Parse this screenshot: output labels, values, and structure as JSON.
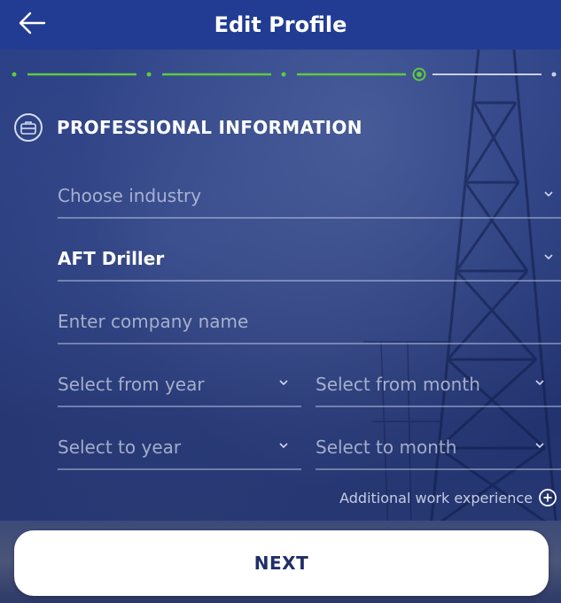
{
  "header": {
    "title": "Edit Profile",
    "back_icon": "arrow-left-icon"
  },
  "stepper": {
    "steps": 5,
    "current_step": 4,
    "active_color": "#5fc940",
    "inactive_color": "#c9d0e6"
  },
  "section": {
    "icon": "briefcase-icon",
    "title": "PROFESSIONAL INFORMATION"
  },
  "form": {
    "industry_placeholder": "Choose industry",
    "role_value": "AFT Driller",
    "company_placeholder": "Enter company name",
    "from_year_placeholder": "Select from year",
    "from_month_placeholder": "Select from month",
    "to_year_placeholder": "Select to year",
    "to_month_placeholder": "Select to month",
    "additional_label": "Additional work experience",
    "additional_icon": "plus-circle-icon"
  },
  "footer": {
    "next_label": "NEXT"
  },
  "colors": {
    "header_bg": "#233c93",
    "button_text": "#1f2e6b"
  }
}
